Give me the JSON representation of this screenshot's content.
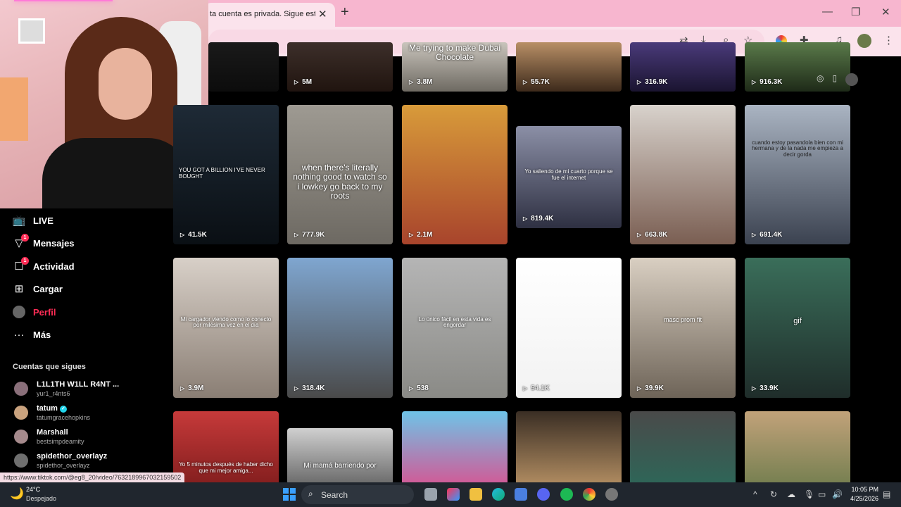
{
  "browser": {
    "tab_title": "ta cuenta es privada. Sigue esta cuenta",
    "tab_close": "✕",
    "new_tab": "+",
    "window_controls": [
      "—",
      "❐",
      "✕"
    ]
  },
  "sidebar": {
    "items": [
      {
        "label": "LIVE",
        "icon": "tv-icon"
      },
      {
        "label": "Mensajes",
        "icon": "send-icon",
        "badge": "1"
      },
      {
        "label": "Actividad",
        "icon": "message-icon",
        "badge": "1"
      },
      {
        "label": "Cargar",
        "icon": "upload-icon"
      },
      {
        "label": "Perfil",
        "icon": "profile-avatar",
        "active": true
      },
      {
        "label": "Más",
        "icon": "more-icon"
      }
    ],
    "following_heading": "Cuentas que sigues",
    "following": [
      {
        "name": "L1L1TH W1LL R4NT ...",
        "handle": "yur1_r4nts6",
        "color": "#8a6f7a"
      },
      {
        "name": "tatum",
        "handle": "tatumgracehopkins",
        "verified": true,
        "color": "#c9a27e"
      },
      {
        "name": "Marshall",
        "handle": "bestsimpdeamity",
        "color": "#a58a8c"
      },
      {
        "name": "spidethor_overlayz",
        "handle": "spidethor_overlayz",
        "color": "#6f6f6f"
      }
    ]
  },
  "grid": {
    "rows": [
      [
        {
          "views": "",
          "caption": "",
          "bg": "linear-gradient(#1a1a1a,#0c0c0c)"
        },
        {
          "views": "5M",
          "caption": "",
          "bg": "linear-gradient(#3d2f2a,#20140f)"
        },
        {
          "views": "3.8M",
          "caption": "Me trying to make Dubai Chocolate",
          "bg": "linear-gradient(#c9c4bc,#6e6a62)"
        },
        {
          "views": "55.7K",
          "caption": "",
          "bg": "linear-gradient(#b88f66,#3d2a1b)"
        },
        {
          "views": "316.9K",
          "caption": "",
          "bg": "linear-gradient(#4a3a7a,#1a1430)"
        },
        {
          "views": "916.3K",
          "caption": "",
          "bg": "linear-gradient(#5a7a4a,#1e2a18)"
        }
      ],
      [
        {
          "views": "41.5K",
          "caption": "YOU GOT A BILLION I'VE NEVER BOUGHT",
          "bg": "linear-gradient(#1e2a36,#0a0f14)"
        },
        {
          "views": "777.9K",
          "caption": "when there's literally nothing good to watch so i lowkey go back to my roots",
          "bg": "linear-gradient(#9e9a92,#6d6962)"
        },
        {
          "views": "2.1M",
          "caption": "",
          "bg": "linear-gradient(#d89b3a,#a8442c)"
        },
        {
          "views": "819.4K",
          "caption": "Yo saliendo de mi cuarto porque se fue el internet",
          "bg": "linear-gradient(#8b8fa6,#2e3042)"
        },
        {
          "views": "663.8K",
          "caption": "",
          "bg": "linear-gradient(#d8d2cc,#7a5e52)"
        },
        {
          "views": "691.4K",
          "caption": "cuando estoy pasandola bien con mi hermana y de la nada me empieza a decir gorda",
          "bg": "linear-gradient(#aab4c2,#3b4250)"
        }
      ],
      [
        {
          "views": "3.9M",
          "caption": "Mi cargador viendo como lo conecto por milésima vez en el día",
          "bg": "linear-gradient(#d8d0c8,#8a7e74)"
        },
        {
          "views": "318.4K",
          "caption": "",
          "bg": "linear-gradient(#7fa6d0,#4a4a4a)"
        },
        {
          "views": "538",
          "caption": "Lo único fácil en esta vida es engordar",
          "bg": "linear-gradient(#b5b5b5,#8a8a86)"
        },
        {
          "views": "54.1K",
          "caption": "",
          "bg": "linear-gradient(#ffffff,#f2f2f2)"
        },
        {
          "views": "39.9K",
          "caption": "masc prom fit",
          "bg": "linear-gradient(#d9cfc2,#6e6458)"
        },
        {
          "views": "33.9K",
          "caption": "gif",
          "bg": "linear-gradient(#3a6e5a,#1f2d2a)"
        }
      ],
      [
        {
          "views": "",
          "caption": "Yo 5 minutos después de haber dicho que mi mejor amiga...",
          "bg": "linear-gradient(#c63a3a,#7a1a1a)"
        },
        {
          "views": "",
          "caption": "Mi mamá barriendo por",
          "bg": "linear-gradient(#d0d0d0,#6a6a6a)"
        },
        {
          "views": "",
          "caption": "",
          "bg": "linear-gradient(#6ec4e8,#e04a8a)"
        },
        {
          "views": "",
          "caption": "",
          "bg": "linear-gradient(#3a2e24,#c29a6a)"
        },
        {
          "views": "",
          "caption": "",
          "bg": "linear-gradient(#4a4a4a,#2a6a5a)"
        },
        {
          "views": "",
          "caption": "",
          "bg": "linear-gradient(#c2a27a,#6a7a4a)"
        }
      ]
    ]
  },
  "status_url": "https://www.tiktok.com/@eg8_20/video/7632189967032159502",
  "taskbar": {
    "temperature": "24°C",
    "weather": "Despejado",
    "search_label": "Search",
    "time": "10:05 PM",
    "date": "4/25/2026"
  }
}
